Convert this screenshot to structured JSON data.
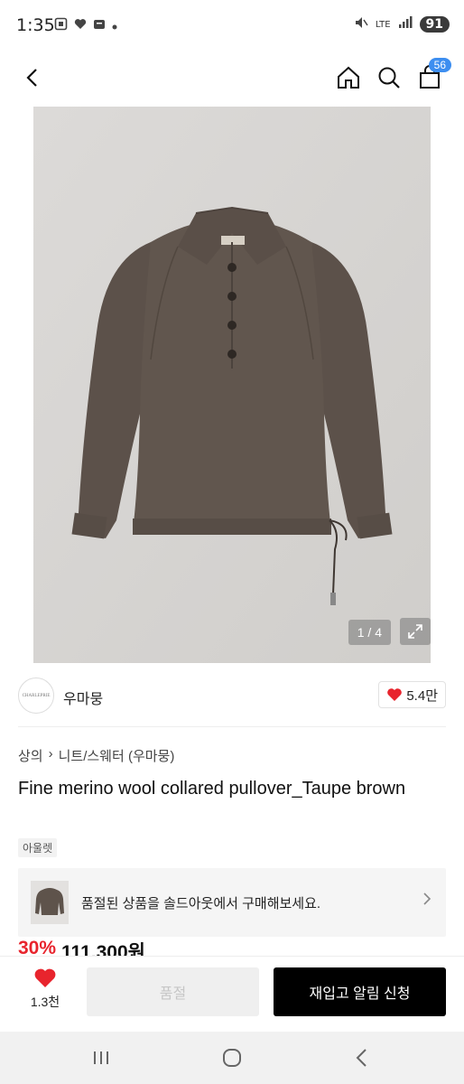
{
  "status": {
    "time": "1:35",
    "network": "LTE",
    "battery": "91"
  },
  "header": {
    "cart_count": "56"
  },
  "gallery": {
    "counter": "1 / 4"
  },
  "seller": {
    "logo_text": "CHARLEPRIE",
    "name": "우마뭉",
    "likes": "5.4만"
  },
  "breadcrumb": {
    "items": [
      "상의",
      "니트/스웨터 (우마뭉)"
    ]
  },
  "product": {
    "title": "Fine merino wool collared pullover_Taupe brown",
    "outlet_label": "아울렛",
    "discount": "30%",
    "price": "111,300원"
  },
  "banner": {
    "text": "품절된 상품을 솔드아웃에서 구매해보세요."
  },
  "actions": {
    "wish_count": "1.3천",
    "soldout_label": "품절",
    "restock_label": "재입고 알림 신청"
  },
  "colors": {
    "accent_red": "#e8242d",
    "badge_blue": "#3d8ef0",
    "sweater": "#5e534b"
  },
  "icons": {
    "back": "chevron-left-icon",
    "home": "home-icon",
    "search": "search-icon",
    "cart": "shopping-bag-icon",
    "expand": "expand-icon",
    "heart": "heart-icon"
  }
}
